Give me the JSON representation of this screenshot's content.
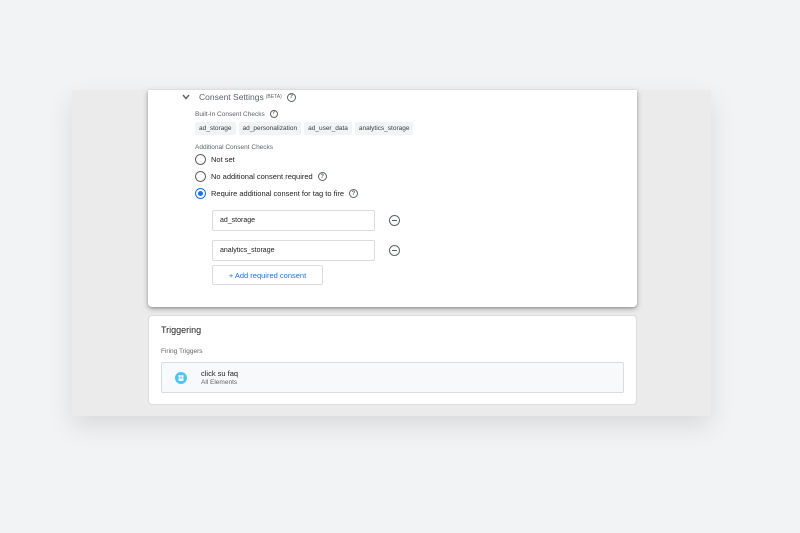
{
  "consent": {
    "title": "Consent Settings",
    "beta": "(BETA)",
    "builtin_label": "Built-In Consent Checks",
    "builtin_chips": [
      "ad_storage",
      "ad_personalization",
      "ad_user_data",
      "analytics_storage"
    ],
    "additional_label": "Additional Consent Checks",
    "options": [
      {
        "label": "Not set",
        "checked": false
      },
      {
        "label": "No additional consent required",
        "checked": false
      },
      {
        "label": "Require additional consent for tag to fire",
        "checked": true
      }
    ],
    "required_consents": [
      "ad_storage",
      "analytics_storage"
    ],
    "add_button_label": "+ Add required consent"
  },
  "triggering": {
    "title": "Triggering",
    "firing_label": "Firing Triggers",
    "trigger": {
      "name": "click su faq",
      "type": "All Elements",
      "icon": "click-trigger-icon"
    }
  },
  "colors": {
    "accent": "#1a73e8",
    "trigger_icon": "#4fc3f7"
  }
}
